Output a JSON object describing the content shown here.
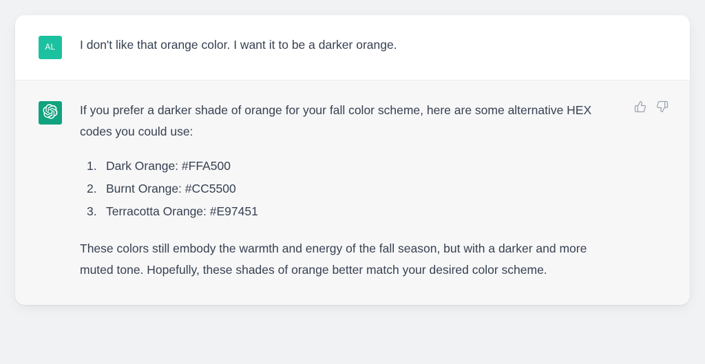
{
  "user": {
    "avatar_initials": "AL",
    "message": "I don't like that orange color. I want it to be a darker orange."
  },
  "assistant": {
    "intro": "If you prefer a darker shade of orange for your fall color scheme, here are some alternative HEX codes you could use:",
    "items": [
      "Dark Orange: #FFA500",
      "Burnt Orange: #CC5500",
      "Terracotta Orange: #E97451"
    ],
    "outro": "These colors still embody the warmth and energy of the fall season, but with a darker and more muted tone. Hopefully, these shades of orange better match your desired color scheme."
  }
}
